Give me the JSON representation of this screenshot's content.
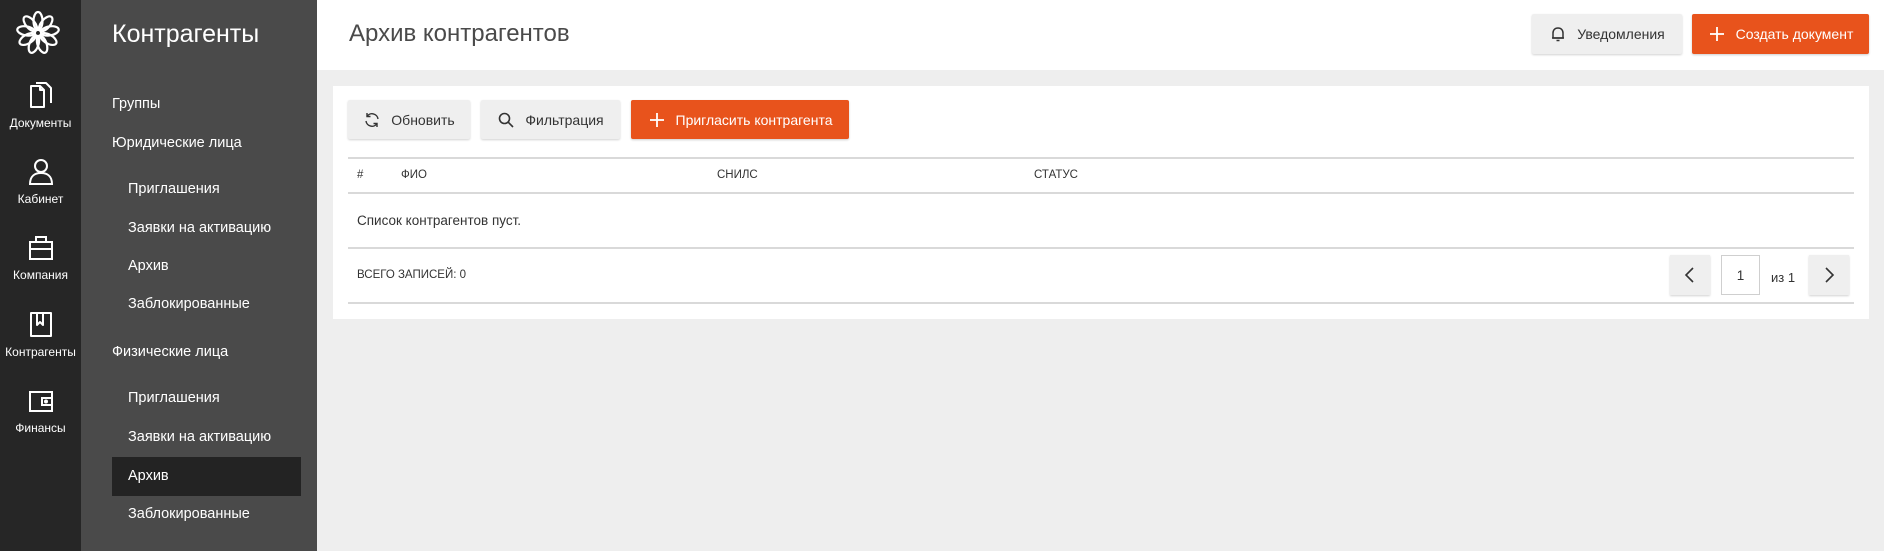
{
  "rail": {
    "items": [
      {
        "label": "Документы",
        "icon": "documents-icon"
      },
      {
        "label": "Кабинет",
        "icon": "user-icon"
      },
      {
        "label": "Компания",
        "icon": "briefcase-icon"
      },
      {
        "label": "Контрагенты",
        "icon": "bookmark-book-icon"
      },
      {
        "label": "Финансы",
        "icon": "wallet-icon"
      }
    ]
  },
  "sidebar": {
    "title": "Контрагенты",
    "groups": [
      {
        "label": "Группы"
      },
      {
        "label": "Юридические лица",
        "items": [
          "Приглашения",
          "Заявки на активацию",
          "Архив",
          "Заблокированные"
        ]
      },
      {
        "label": "Физические лица",
        "items": [
          "Приглашения",
          "Заявки на активацию",
          "Архив",
          "Заблокированные"
        ],
        "active_item": "Архив"
      }
    ]
  },
  "header": {
    "title": "Архив контрагентов",
    "notifications_label": "Уведомления",
    "create_label": "Создать документ"
  },
  "toolbar": {
    "refresh_label": "Обновить",
    "filter_label": "Фильтрация",
    "invite_label": "Пригласить контрагента"
  },
  "table": {
    "columns": [
      "#",
      "ФИО",
      "СНИЛС",
      "СТАТУС"
    ],
    "empty_text": "Список контрагентов пуст.",
    "total_label": "ВСЕГО ЗАПИСЕЙ: 0"
  },
  "pagination": {
    "current_page": "1",
    "of_label": "из 1"
  },
  "colors": {
    "accent": "#e8531c",
    "rail_bg": "#262626",
    "sidebar_bg": "#4a4a4a",
    "active_item_bg": "#232323"
  }
}
